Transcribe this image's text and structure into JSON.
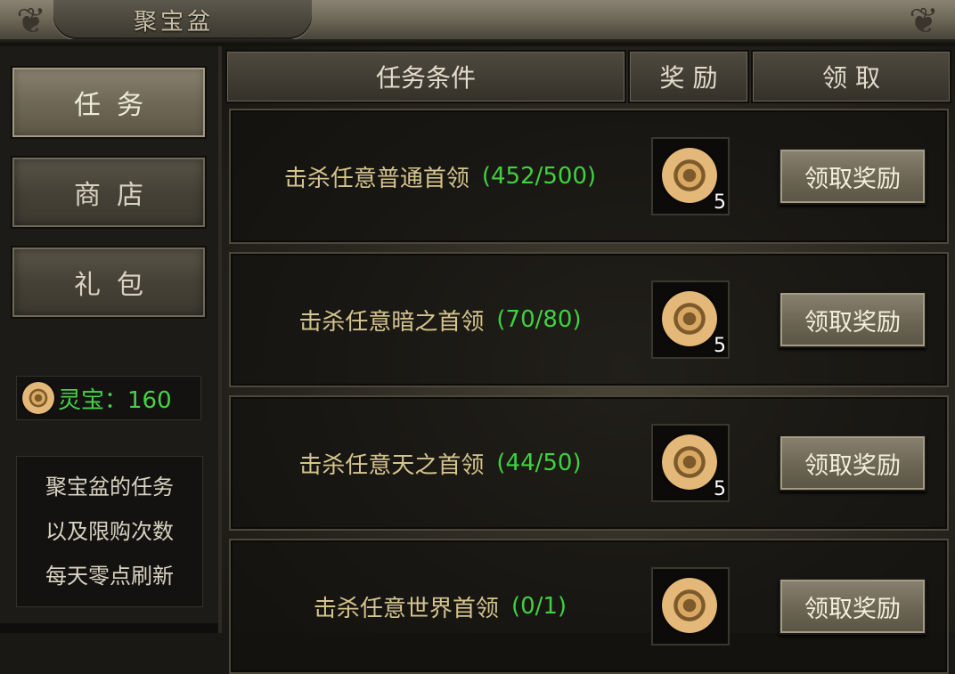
{
  "window": {
    "title": "聚宝盆"
  },
  "sidebar": {
    "tabs": [
      {
        "label": "任务",
        "active": true
      },
      {
        "label": "商店",
        "active": false
      },
      {
        "label": "礼包",
        "active": false
      }
    ],
    "currency": {
      "label": "灵宝：160",
      "icon": "jade-coin-icon"
    },
    "info_lines": [
      "聚宝盆的任务",
      "以及限购次数",
      "每天零点刷新"
    ]
  },
  "table": {
    "headers": {
      "condition": "任务条件",
      "reward": "奖 励",
      "claim": "领 取"
    },
    "rows": [
      {
        "task": "击杀任意普通首领",
        "progress": "(452/500)",
        "reward_icon": "jade-coin-icon",
        "reward_count": "5",
        "button": "领取奖励"
      },
      {
        "task": "击杀任意暗之首领",
        "progress": "(70/80)",
        "reward_icon": "jade-coin-icon",
        "reward_count": "5",
        "button": "领取奖励"
      },
      {
        "task": "击杀任意天之首领",
        "progress": "(44/50)",
        "reward_icon": "jade-coin-icon",
        "reward_count": "5",
        "button": "领取奖励"
      },
      {
        "task": "击杀任意世界首领",
        "progress": "(0/1)",
        "reward_icon": "jade-coin-icon",
        "reward_count": "",
        "button": "领取奖励"
      }
    ]
  },
  "colors": {
    "progress": "#3fd13f",
    "task_text": "#d4c48e",
    "currency": "#47d147"
  }
}
